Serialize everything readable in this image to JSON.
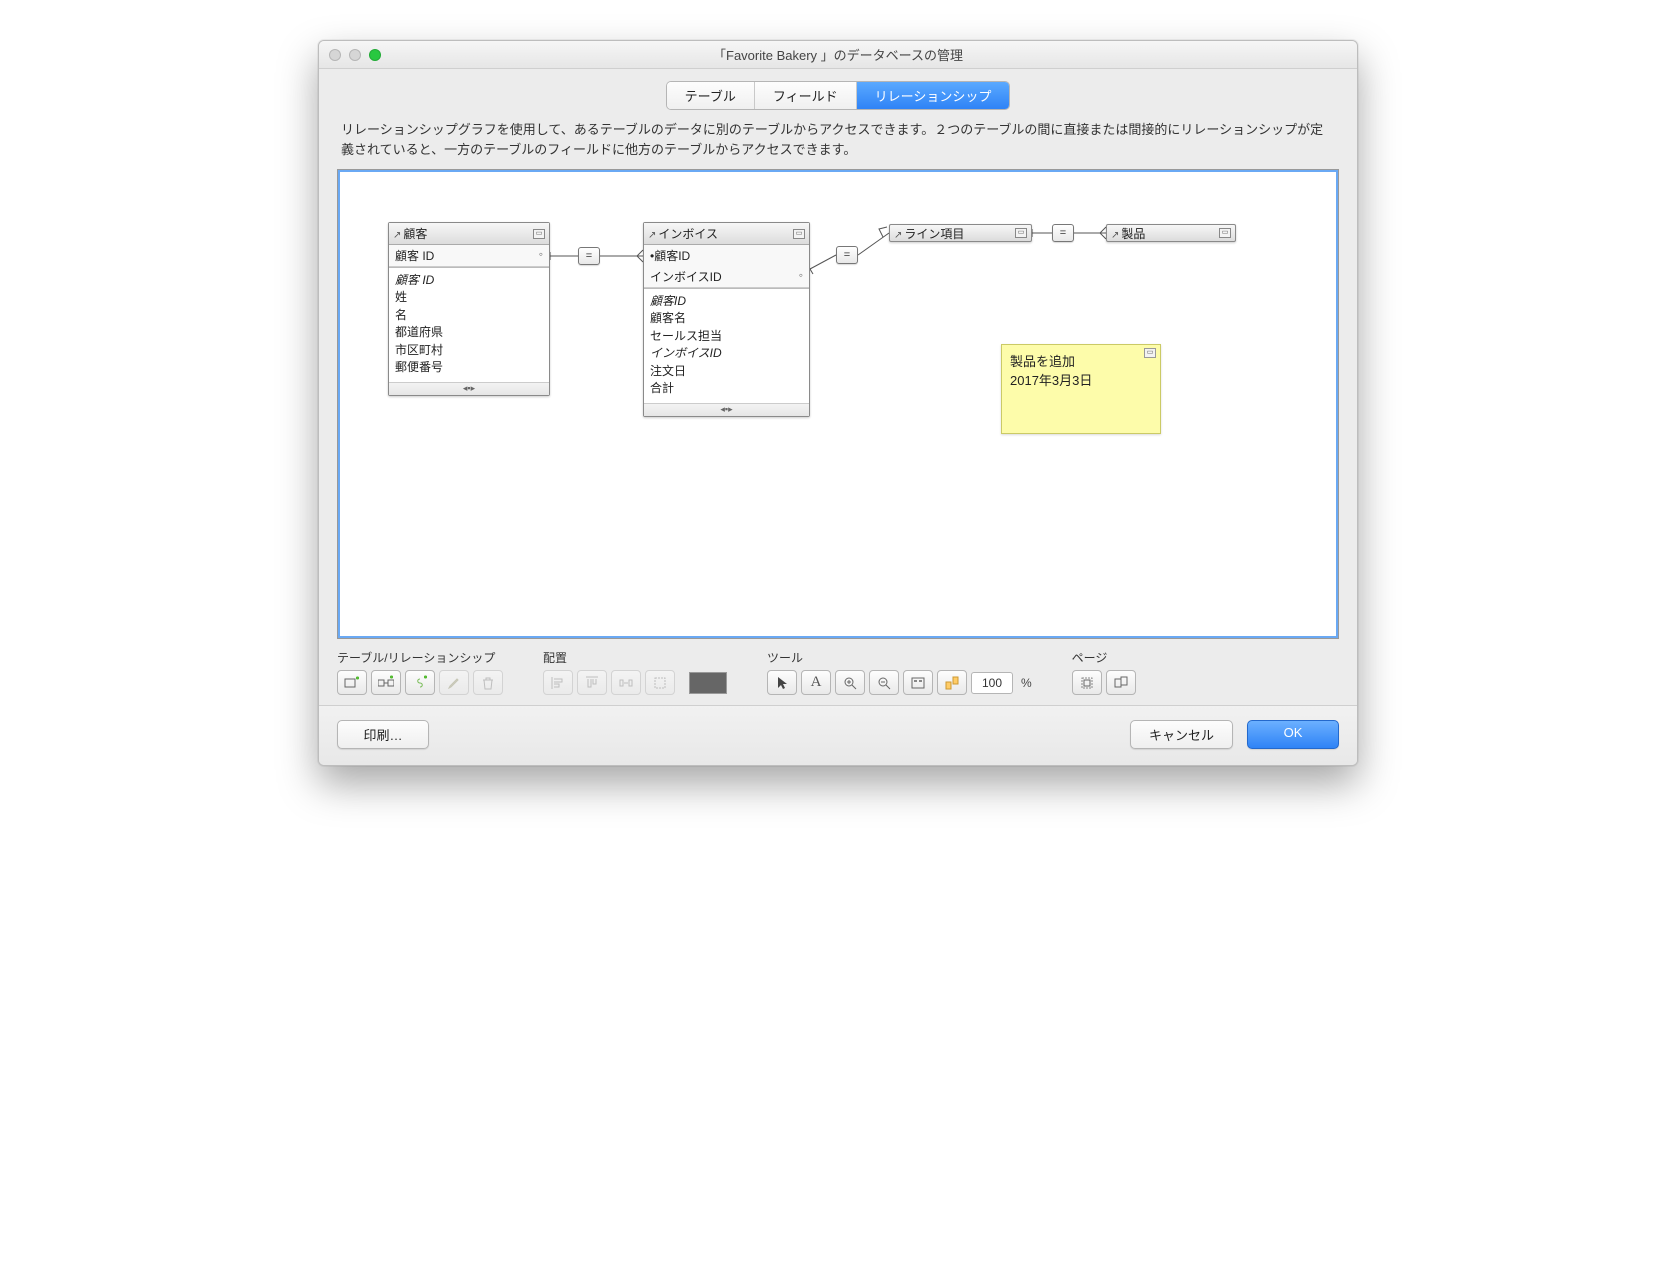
{
  "window": {
    "title": "「Favorite Bakery 」のデータベースの管理"
  },
  "tabs": {
    "table": "テーブル",
    "field": "フィールド",
    "relationship": "リレーションシップ"
  },
  "description": "リレーションシップグラフを使用して、あるテーブルのデータに別のテーブルからアクセスできます。２つのテーブルの間に直接または間接的にリレーションシップが定義されていると、一方のテーブルのフィールドに他方のテーブルからアクセスできます。",
  "joins": {
    "eq1": "=",
    "eq2": "=",
    "eq3": "="
  },
  "tables": {
    "customer": {
      "title": "顧客",
      "key": "顧客 ID",
      "fields": [
        "顧客 ID",
        "姓",
        "名",
        "都道府県",
        "市区町村",
        "郵便番号"
      ]
    },
    "invoice": {
      "title": "インボイス",
      "keys": [
        "顧客ID",
        "インボイスID"
      ],
      "fields": [
        "顧客ID",
        "顧客名",
        "セールス担当",
        "インボイスID",
        "注文日",
        "合計"
      ]
    },
    "lineitem": {
      "title": "ライン項目"
    },
    "product": {
      "title": "製品"
    }
  },
  "note": {
    "line1": "製品を追加",
    "line2": "2017年3月3日"
  },
  "toolgroups": {
    "tablerel": "テーブル/リレーションシップ",
    "layout": "配置",
    "tool": "ツール",
    "page": "ページ"
  },
  "zoom": {
    "value": "100",
    "pct": "%"
  },
  "footer": {
    "print": "印刷…",
    "cancel": "キャンセル",
    "ok": "OK"
  }
}
